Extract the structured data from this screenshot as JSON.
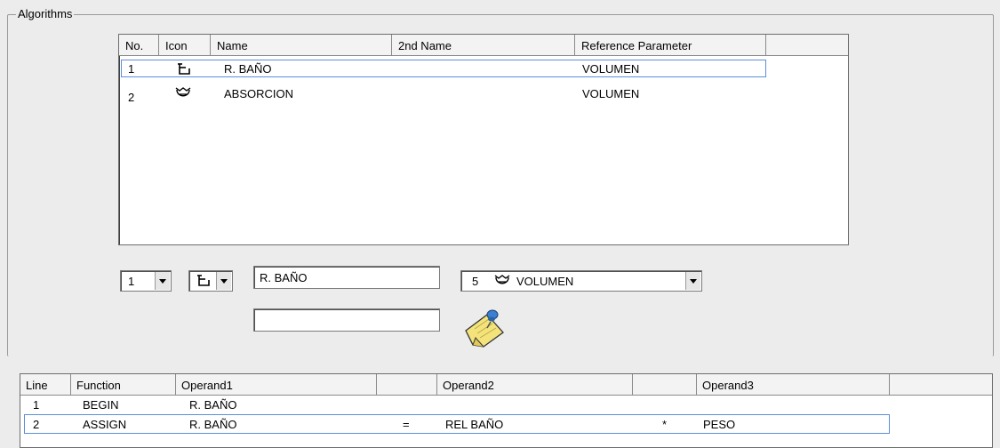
{
  "group_title": "Algorithms",
  "algorithms_table": {
    "columns": [
      "No.",
      "Icon",
      "Name",
      "2nd Name",
      "Reference Parameter"
    ],
    "rows": [
      {
        "no": "1",
        "icon": "bath-icon",
        "name": "R. BAÑO",
        "second_name": "",
        "reference": "VOLUMEN"
      },
      {
        "no": "2",
        "icon": "absorption-icon",
        "name": "ABSORCION",
        "second_name": "",
        "reference": "VOLUMEN"
      }
    ],
    "selected_row": 1
  },
  "editor": {
    "number_value": "1",
    "icon_value": "bath-icon",
    "name_value": "R. BAÑO",
    "second_name_value": "",
    "reference_number": "5",
    "reference_icon": "absorption-icon",
    "reference_value": "VOLUMEN",
    "note_icon": "sticky-note-pin-icon"
  },
  "lines_table": {
    "columns": [
      "Line",
      "Function",
      "Operand1",
      "",
      "Operand2",
      "",
      "Operand3"
    ],
    "rows": [
      {
        "line": "1",
        "function": "BEGIN",
        "op1": "R. BAÑO",
        "op_a": "",
        "op2": "",
        "op_b": "",
        "op3": ""
      },
      {
        "line": "2",
        "function": "ASSIGN",
        "op1": "R. BAÑO",
        "op_a": "=",
        "op2": "REL BAÑO",
        "op_b": "*",
        "op3": "PESO"
      }
    ],
    "selected_row": 2
  },
  "colors": {
    "background": "#ececec",
    "selection_border": "#5b8fd8",
    "note_yellow": "#f3e37a",
    "pin_blue": "#3a7fd0"
  }
}
